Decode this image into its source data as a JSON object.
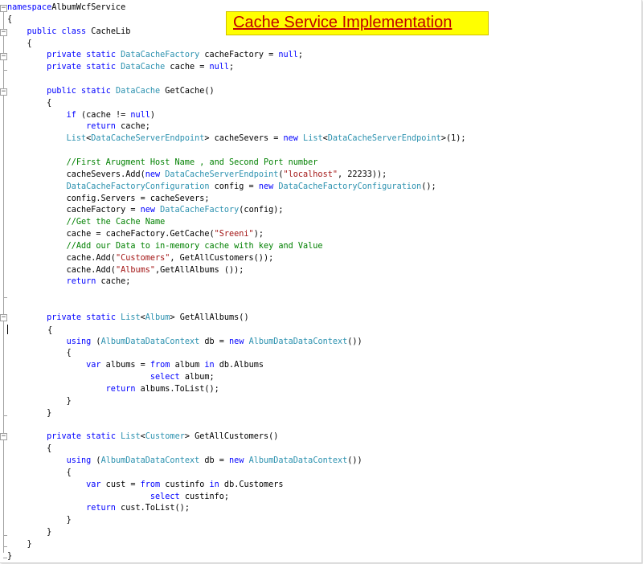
{
  "banner": {
    "title": "Cache Service Implementation"
  },
  "code_lines": [
    [
      [
        "kw",
        "namespace"
      ],
      [
        "",
        "AlbumWcfService"
      ]
    ],
    [
      [
        "",
        "{"
      ]
    ],
    [
      [
        "",
        "    "
      ],
      [
        "kw",
        "public"
      ],
      [
        "",
        ""
      ],
      [
        "kw",
        " class"
      ],
      [
        "",
        " CacheLib"
      ]
    ],
    [
      [
        "",
        "    {"
      ]
    ],
    [
      [
        "",
        "        "
      ],
      [
        "kw",
        "private"
      ],
      [
        "kw",
        " static"
      ],
      [
        "ty",
        " DataCacheFactory"
      ],
      [
        "",
        " cacheFactory = "
      ],
      [
        "kw",
        "null"
      ],
      [
        "",
        ";"
      ]
    ],
    [
      [
        "",
        "        "
      ],
      [
        "kw",
        "private"
      ],
      [
        "kw",
        " static"
      ],
      [
        "ty",
        " DataCache"
      ],
      [
        "",
        " cache = "
      ],
      [
        "kw",
        "null"
      ],
      [
        "",
        ";"
      ]
    ],
    [
      [
        "",
        ""
      ]
    ],
    [
      [
        "",
        "        "
      ],
      [
        "kw",
        "public"
      ],
      [
        "kw",
        " static"
      ],
      [
        "ty",
        " DataCache"
      ],
      [
        "",
        " GetCache()"
      ]
    ],
    [
      [
        "",
        "        {"
      ]
    ],
    [
      [
        "",
        "            "
      ],
      [
        "kw",
        "if"
      ],
      [
        "",
        " (cache != "
      ],
      [
        "kw",
        "null"
      ],
      [
        "",
        ")"
      ]
    ],
    [
      [
        "",
        "                "
      ],
      [
        "kw",
        "return"
      ],
      [
        "",
        " cache;"
      ]
    ],
    [
      [
        "",
        "            "
      ],
      [
        "ty",
        "List"
      ],
      [
        "",
        "<"
      ],
      [
        "ty",
        "DataCacheServerEndpoint"
      ],
      [
        "",
        "> cacheSevers = "
      ],
      [
        "kw",
        "new"
      ],
      [
        "ty",
        " List"
      ],
      [
        "",
        "<"
      ],
      [
        "ty",
        "DataCacheServerEndpoint"
      ],
      [
        "",
        ">(1);"
      ]
    ],
    [
      [
        "",
        ""
      ]
    ],
    [
      [
        "",
        "            "
      ],
      [
        "cm",
        "//First Arugment Host Name , and Second Port number"
      ]
    ],
    [
      [
        "",
        "            cacheSevers.Add("
      ],
      [
        "kw",
        "new"
      ],
      [
        "ty",
        " DataCacheServerEndpoint"
      ],
      [
        "",
        "("
      ],
      [
        "st",
        "\"localhost\""
      ],
      [
        "",
        ", 22233));"
      ]
    ],
    [
      [
        "",
        "            "
      ],
      [
        "ty",
        "DataCacheFactoryConfiguration"
      ],
      [
        "",
        " config = "
      ],
      [
        "kw",
        "new"
      ],
      [
        "ty",
        " DataCacheFactoryConfiguration"
      ],
      [
        "",
        "();"
      ]
    ],
    [
      [
        "",
        "            config.Servers = cacheSevers;"
      ]
    ],
    [
      [
        "",
        "            cacheFactory = "
      ],
      [
        "kw",
        "new"
      ],
      [
        "ty",
        " DataCacheFactory"
      ],
      [
        "",
        "(config);"
      ]
    ],
    [
      [
        "",
        "            "
      ],
      [
        "cm",
        "//Get the Cache Name"
      ]
    ],
    [
      [
        "",
        "            cache = cacheFactory.GetCache("
      ],
      [
        "st",
        "\"Sreeni\""
      ],
      [
        "",
        ");"
      ]
    ],
    [
      [
        "",
        "            "
      ],
      [
        "cm",
        "//Add our Data to in-memory cache with key and Value"
      ]
    ],
    [
      [
        "",
        "            cache.Add("
      ],
      [
        "st",
        "\"Customers\""
      ],
      [
        "",
        ", GetAllCustomers());"
      ]
    ],
    [
      [
        "",
        "            cache.Add("
      ],
      [
        "st",
        "\"Albums\""
      ],
      [
        "",
        ",GetAllAlbums ());"
      ]
    ],
    [
      [
        "",
        "            "
      ],
      [
        "kw",
        "return"
      ],
      [
        "",
        " cache;"
      ]
    ],
    [
      [
        "",
        ""
      ]
    ],
    [
      [
        "",
        ""
      ]
    ],
    [
      [
        "",
        "        "
      ],
      [
        "kw",
        "private"
      ],
      [
        "kw",
        " static"
      ],
      [
        "ty",
        " List"
      ],
      [
        "",
        "<"
      ],
      [
        "ty",
        "Album"
      ],
      [
        "",
        "> GetAllAlbums()"
      ]
    ],
    [
      [
        "",
        "        {"
      ]
    ],
    [
      [
        "",
        "            "
      ],
      [
        "kw",
        "using"
      ],
      [
        "",
        " ("
      ],
      [
        "ty",
        "AlbumDataDataContext"
      ],
      [
        "",
        " db = "
      ],
      [
        "kw",
        "new"
      ],
      [
        "ty",
        " AlbumDataDataContext"
      ],
      [
        "",
        "())"
      ]
    ],
    [
      [
        "",
        "            {"
      ]
    ],
    [
      [
        "",
        "                "
      ],
      [
        "kw",
        "var"
      ],
      [
        "",
        " albums = "
      ],
      [
        "kw",
        "from"
      ],
      [
        "",
        " album "
      ],
      [
        "kw",
        "in"
      ],
      [
        "",
        " db.Albums"
      ]
    ],
    [
      [
        "",
        "                             "
      ],
      [
        "kw",
        "select"
      ],
      [
        "",
        " album;"
      ]
    ],
    [
      [
        "",
        "                    "
      ],
      [
        "kw",
        "return"
      ],
      [
        "",
        " albums.ToList();"
      ]
    ],
    [
      [
        "",
        "            }"
      ]
    ],
    [
      [
        "",
        "        }"
      ]
    ],
    [
      [
        "",
        ""
      ]
    ],
    [
      [
        "",
        "        "
      ],
      [
        "kw",
        "private"
      ],
      [
        "kw",
        " static"
      ],
      [
        "ty",
        " List"
      ],
      [
        "",
        "<"
      ],
      [
        "ty",
        "Customer"
      ],
      [
        "",
        "> GetAllCustomers()"
      ]
    ],
    [
      [
        "",
        "        {"
      ]
    ],
    [
      [
        "",
        "            "
      ],
      [
        "kw",
        "using"
      ],
      [
        "",
        " ("
      ],
      [
        "ty",
        "AlbumDataDataContext"
      ],
      [
        "",
        " db = "
      ],
      [
        "kw",
        "new"
      ],
      [
        "ty",
        " AlbumDataDataContext"
      ],
      [
        "",
        "())"
      ]
    ],
    [
      [
        "",
        "            {"
      ]
    ],
    [
      [
        "",
        "                "
      ],
      [
        "kw",
        "var"
      ],
      [
        "",
        " cust = "
      ],
      [
        "kw",
        "from"
      ],
      [
        "",
        " custinfo "
      ],
      [
        "kw",
        "in"
      ],
      [
        "",
        " db.Customers"
      ]
    ],
    [
      [
        "",
        "                             "
      ],
      [
        "kw",
        "select"
      ],
      [
        "",
        " custinfo;"
      ]
    ],
    [
      [
        "",
        "                "
      ],
      [
        "kw",
        "return"
      ],
      [
        "",
        " cust.ToList();"
      ]
    ],
    [
      [
        "",
        "            }"
      ]
    ],
    [
      [
        "",
        "        }"
      ]
    ],
    [
      [
        "",
        "    }"
      ]
    ],
    [
      [
        "",
        "}"
      ]
    ]
  ],
  "colors": {
    "keyword": "#0000ff",
    "type": "#2b91af",
    "string": "#a31515",
    "comment": "#008000",
    "banner_bg": "#ffff00",
    "banner_text": "#c00000"
  }
}
